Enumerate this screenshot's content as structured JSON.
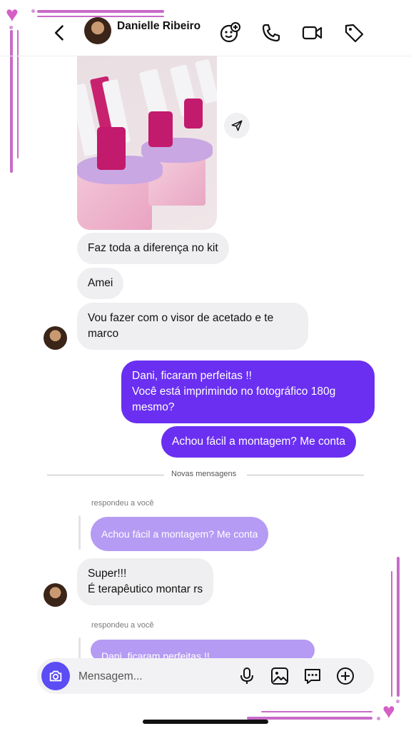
{
  "header": {
    "contact_name": "Danielle Ribeiro",
    "icons": [
      "back-icon",
      "add-reaction-icon",
      "phone-icon",
      "video-icon",
      "tag-icon"
    ]
  },
  "messages": {
    "m1": "Faz toda a diferença no kit",
    "m2": "Amei",
    "m3": "Vou fazer com o visor de acetado e te\nmarco",
    "m4": "Dani, ficaram perfeitas !!\nVocê está imprimindo no fotográfico 180g\nmesmo?",
    "m5": "Achou fácil a montagem? Me conta",
    "separator": "Novas mensagens",
    "reply_label_1": "respondeu a você",
    "quoted_1": "Achou fácil a montagem? Me conta",
    "m6": "Super!!!\nÉ terapêutico montar rs",
    "reply_label_2": "respondeu a você",
    "quoted_2": "Dani, ficaram perfeitas !!"
  },
  "composer": {
    "placeholder": "Mensagem..."
  },
  "colors": {
    "outgoing": "#6a2ff1",
    "incoming": "#efeff1",
    "quoted": "#b59bf3",
    "camera": "#5b4cf4",
    "frame": "#c86bc8"
  }
}
